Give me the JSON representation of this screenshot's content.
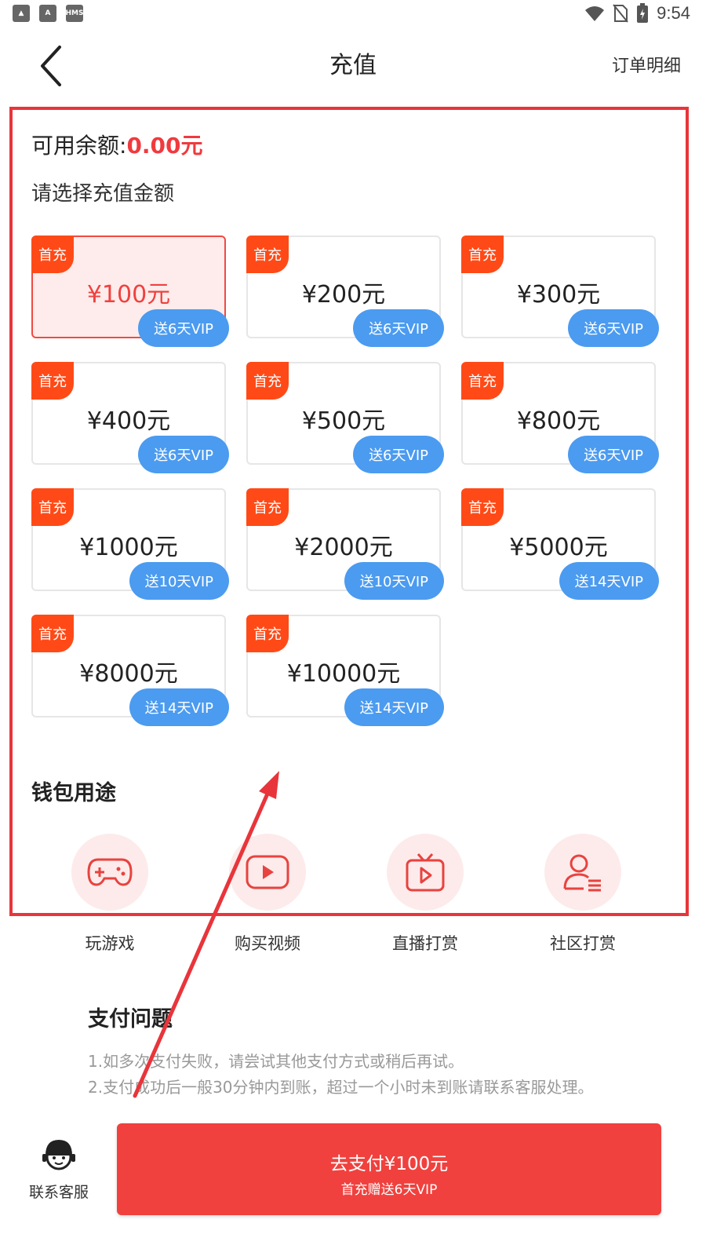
{
  "status_bar": {
    "time": "9:54",
    "icons_left": [
      "gallery-icon",
      "a-icon",
      "hms-icon"
    ],
    "hms": "HMS"
  },
  "nav": {
    "title": "充值",
    "order_details": "订单明细"
  },
  "balance": {
    "label": "可用余额:",
    "amount": "0.00元"
  },
  "select_label": "请选择充值金额",
  "options": [
    {
      "tag": "首充",
      "price": "¥100元",
      "bonus": "送6天VIP",
      "selected": true
    },
    {
      "tag": "首充",
      "price": "¥200元",
      "bonus": "送6天VIP"
    },
    {
      "tag": "首充",
      "price": "¥300元",
      "bonus": "送6天VIP"
    },
    {
      "tag": "首充",
      "price": "¥400元",
      "bonus": "送6天VIP"
    },
    {
      "tag": "首充",
      "price": "¥500元",
      "bonus": "送6天VIP"
    },
    {
      "tag": "首充",
      "price": "¥800元",
      "bonus": "送6天VIP"
    },
    {
      "tag": "首充",
      "price": "¥1000元",
      "bonus": "送10天VIP"
    },
    {
      "tag": "首充",
      "price": "¥2000元",
      "bonus": "送10天VIP"
    },
    {
      "tag": "首充",
      "price": "¥5000元",
      "bonus": "送14天VIP"
    },
    {
      "tag": "首充",
      "price": "¥8000元",
      "bonus": "送14天VIP"
    },
    {
      "tag": "首充",
      "price": "¥10000元",
      "bonus": "送14天VIP"
    }
  ],
  "wallet": {
    "title": "钱包用途",
    "uses": [
      {
        "label": "玩游戏",
        "icon": "gamepad-icon"
      },
      {
        "label": "购买视频",
        "icon": "play-video-icon"
      },
      {
        "label": "直播打赏",
        "icon": "tv-live-icon"
      },
      {
        "label": "社区打赏",
        "icon": "user-list-icon"
      }
    ]
  },
  "faq": {
    "title": "支付问题",
    "lines": [
      "1.如多次支付失败，请尝试其他支付方式或稍后再试。",
      "2.支付成功后一般30分钟内到账，超过一个小时未到账请联系客服处理。"
    ]
  },
  "bottom": {
    "customer_service": "联系客服",
    "pay_main": "去支付¥100元",
    "pay_sub": "首充赠送6天VIP"
  },
  "colors": {
    "accent_red": "#f0413e",
    "tag_orange": "#ff4a17",
    "vip_blue": "#4b9bf0",
    "annotation_red": "#e8353b"
  }
}
